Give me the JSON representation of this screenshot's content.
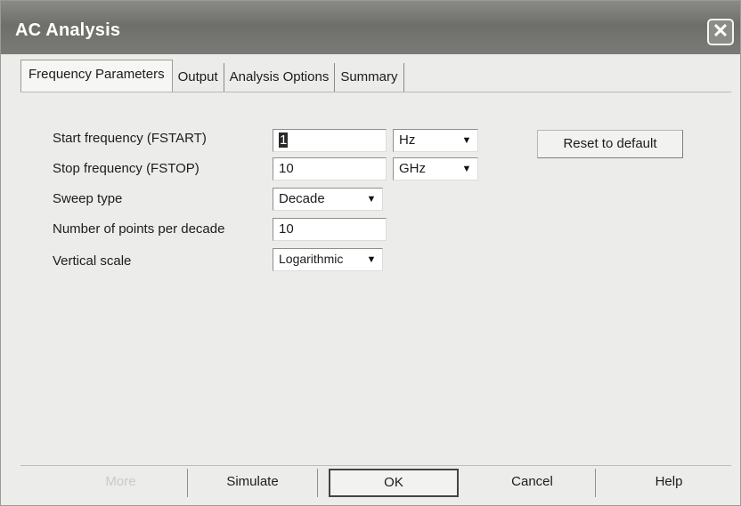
{
  "window": {
    "title": "AC Analysis",
    "close_glyph": "✕"
  },
  "tabs": [
    {
      "label": "Frequency Parameters",
      "active": true
    },
    {
      "label": "Output",
      "active": false
    },
    {
      "label": "Analysis Options",
      "active": false
    },
    {
      "label": "Summary",
      "active": false
    }
  ],
  "form": {
    "start_frequency": {
      "label": "Start frequency (FSTART)",
      "value": "1",
      "unit": "Hz"
    },
    "stop_frequency": {
      "label": "Stop frequency (FSTOP)",
      "value": "10",
      "unit": "GHz"
    },
    "sweep_type": {
      "label": "Sweep type",
      "value": "Decade"
    },
    "points_per_decade": {
      "label": "Number of points per decade",
      "value": "10"
    },
    "vertical_scale": {
      "label": "Vertical scale",
      "value": "Logarithmic"
    }
  },
  "buttons": {
    "reset": "Reset to default",
    "more": "More",
    "simulate": "Simulate",
    "ok": "OK",
    "cancel": "Cancel",
    "help": "Help"
  },
  "icons": {
    "dropdown": "▼"
  }
}
